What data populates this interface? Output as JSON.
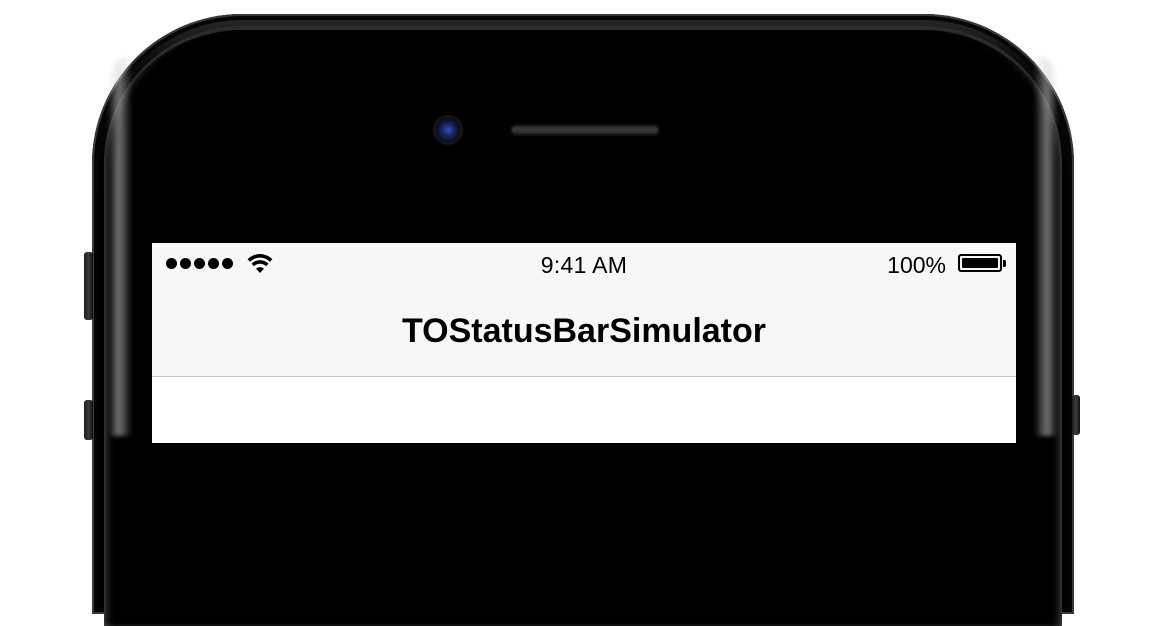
{
  "status_bar": {
    "signal_bars_filled": 5,
    "signal_bars_total": 5,
    "wifi_icon": "wifi-icon",
    "time": "9:41 AM",
    "battery_percent_label": "100%",
    "battery_level": 1.0
  },
  "navigation_bar": {
    "title": "TOStatusBarSimulator"
  },
  "colors": {
    "navbar_background": "#f7f7f7",
    "screen_background": "#ffffff",
    "separator": "#c8c7cc",
    "phone_body": "#000000",
    "camera_lens": "#2f4fb8"
  }
}
